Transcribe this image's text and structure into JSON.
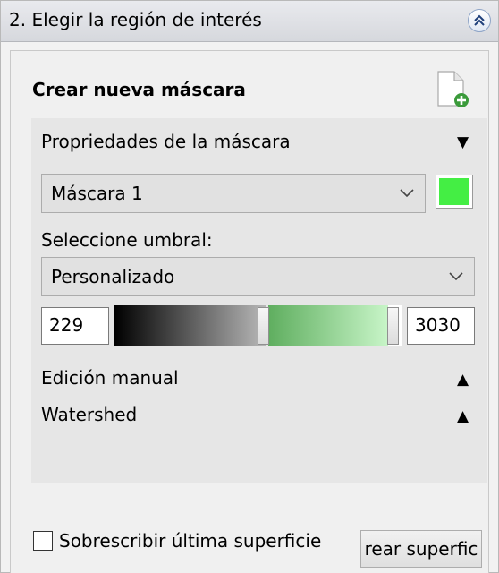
{
  "panel": {
    "title": "2. Elegir la región de interés",
    "collapse_icon": "double-chevron-up-icon"
  },
  "mask": {
    "heading": "Crear nueva máscara",
    "new_mask_icon": "new-mask-document-icon"
  },
  "properties": {
    "title": "Propriedades de la máscara",
    "toggle_glyph": "▼",
    "mask_selected": "Máscara 1",
    "mask_color": "#44ee44",
    "threshold_label": "Seleccione umbral:",
    "threshold_preset": "Personalizado",
    "threshold_min": "229",
    "threshold_max": "3030"
  },
  "sections": {
    "manual_edit": "Edición manual",
    "manual_edit_glyph": "▲",
    "watershed": "Watershed",
    "watershed_glyph": "▲"
  },
  "footer": {
    "overwrite_label": "Sobrescribir última superficie",
    "overwrite_checked": false,
    "create_button": "rear superfic"
  },
  "colors": {
    "accent": "#3c8f3c",
    "track_green_start": "#5fae5f",
    "track_green_end": "#c8f5c8"
  }
}
